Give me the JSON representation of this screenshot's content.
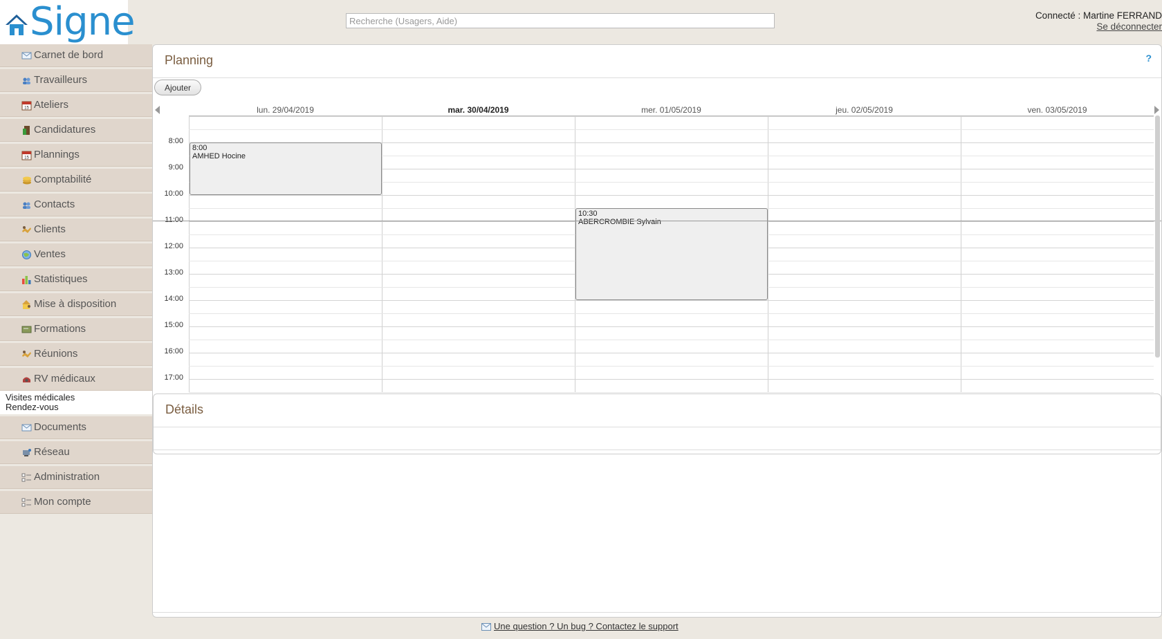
{
  "logo": {
    "brand": "Signe"
  },
  "search": {
    "placeholder": "Recherche (Usagers, Aide)"
  },
  "user": {
    "connected": "Connecté : Martine FERRAND",
    "logout": "Se déconnecter"
  },
  "sidebar": {
    "items": [
      {
        "label": "Carnet de bord",
        "icon": "envelope-icon"
      },
      {
        "label": "Travailleurs",
        "icon": "users-icon"
      },
      {
        "label": "Ateliers",
        "icon": "calendar-icon"
      },
      {
        "label": "Candidatures",
        "icon": "door-icon"
      },
      {
        "label": "Plannings",
        "icon": "calendar-icon"
      },
      {
        "label": "Comptabilité",
        "icon": "coins-icon"
      },
      {
        "label": "Contacts",
        "icon": "users-icon"
      },
      {
        "label": "Clients",
        "icon": "handshake-icon"
      },
      {
        "label": "Ventes",
        "icon": "globe-icon"
      },
      {
        "label": "Statistiques",
        "icon": "bar-chart-icon"
      },
      {
        "label": "Mise à disposition",
        "icon": "house-person-icon"
      },
      {
        "label": "Formations",
        "icon": "board-icon"
      },
      {
        "label": "Réunions",
        "icon": "handshake-icon"
      },
      {
        "label": "RV médicaux",
        "icon": "medical-icon"
      }
    ],
    "subitems": [
      "Visites médicales",
      "Rendez-vous"
    ],
    "items_after": [
      {
        "label": "Documents",
        "icon": "envelope-icon"
      },
      {
        "label": "Réseau",
        "icon": "network-icon"
      },
      {
        "label": "Administration",
        "icon": "list-icon"
      },
      {
        "label": "Mon compte",
        "icon": "list-icon"
      }
    ]
  },
  "main": {
    "title": "Planning",
    "help": "?",
    "add_label": "Ajouter",
    "details_title": "Détails"
  },
  "calendar": {
    "days": [
      "lun. 29/04/2019",
      "mar. 30/04/2019",
      "mer. 01/05/2019",
      "jeu. 02/05/2019",
      "ven. 03/05/2019"
    ],
    "today_index": 1,
    "times": [
      "8:00",
      "9:00",
      "10:00",
      "11:00",
      "12:00",
      "13:00",
      "14:00",
      "15:00",
      "16:00",
      "17:00"
    ],
    "first_hour": 7,
    "current_time": "11:00",
    "events": [
      {
        "day": 0,
        "start": "8:00",
        "end": "10:00",
        "time": "8:00",
        "name": "AMHED Hocine"
      },
      {
        "day": 2,
        "start": "10:30",
        "end": "14:00",
        "time": "10:30",
        "name": "ABERCROMBIE Sylvain"
      }
    ]
  },
  "footer": {
    "text": "Une question ? Un bug ? Contactez le support"
  },
  "colors": {
    "accent": "#2a8fcf",
    "title": "#7a5d40",
    "sidebar_bg": "#e0d6cc",
    "page_bg": "#ece8e1"
  }
}
